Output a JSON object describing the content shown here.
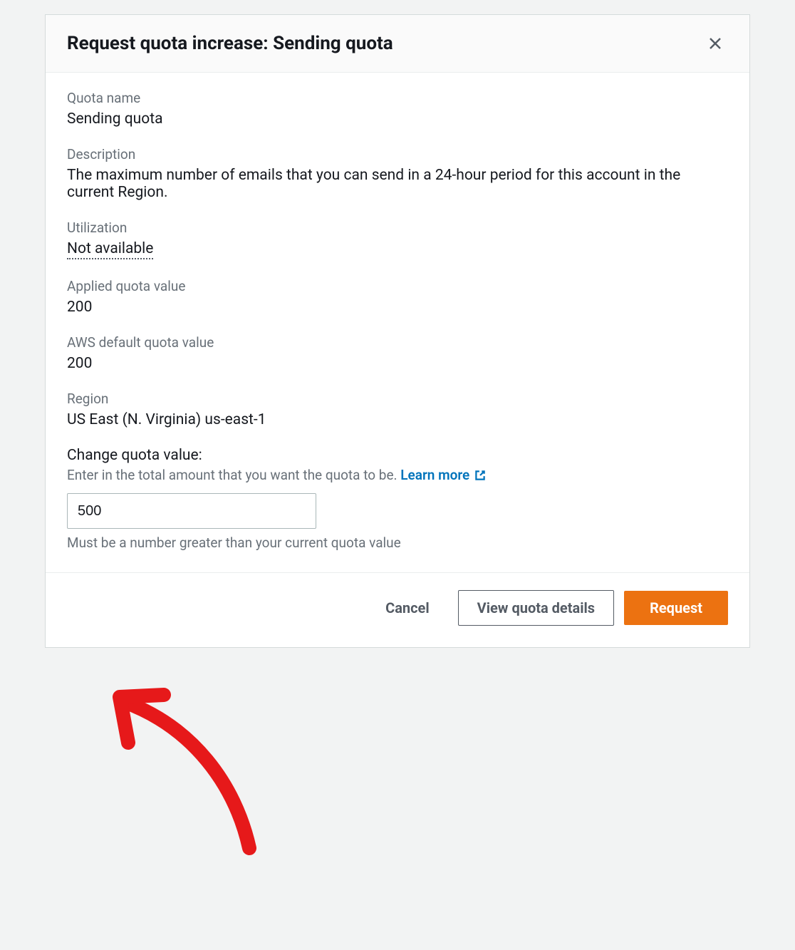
{
  "header": {
    "title": "Request quota increase: Sending quota"
  },
  "fields": {
    "quota_name": {
      "label": "Quota name",
      "value": "Sending quota"
    },
    "description": {
      "label": "Description",
      "value": "The maximum number of emails that you can send in a 24-hour period for this account in the current Region."
    },
    "utilization": {
      "label": "Utilization",
      "value": "Not available"
    },
    "applied": {
      "label": "Applied quota value",
      "value": "200"
    },
    "default": {
      "label": "AWS default quota value",
      "value": "200"
    },
    "region": {
      "label": "Region",
      "value": "US East (N. Virginia) us-east-1"
    },
    "change": {
      "label": "Change quota value:",
      "hint_prefix": "Enter in the total amount that you want the quota to be. ",
      "learn_more": "Learn more",
      "input_value": "500",
      "input_hint": "Must be a number greater than your current quota value"
    }
  },
  "footer": {
    "cancel": "Cancel",
    "view_details": "View quota details",
    "request": "Request"
  },
  "colors": {
    "primary_button": "#ec7211",
    "link": "#0073bb",
    "annotation_arrow": "#e6191a"
  }
}
